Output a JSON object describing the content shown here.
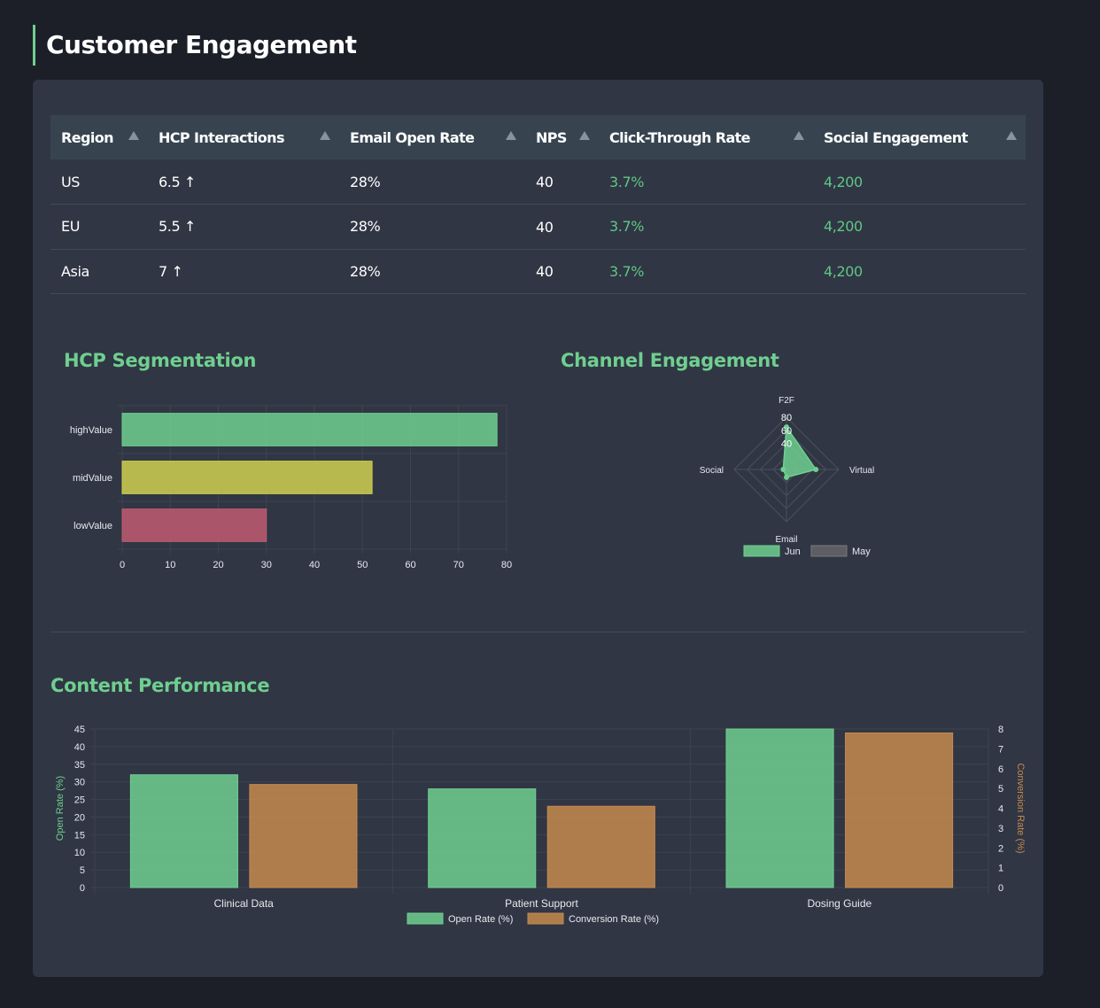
{
  "page": {
    "title": "Customer Engagement"
  },
  "table": {
    "columns": [
      "Region",
      "HCP Interactions",
      "Email Open Rate",
      "NPS",
      "Click-Through Rate",
      "Social Engagement"
    ],
    "rows": [
      {
        "region": "US",
        "hcp": "6.5 ↑",
        "email": "28%",
        "nps": "40",
        "ctr": "3.7%",
        "social": "4,200"
      },
      {
        "region": "EU",
        "hcp": "5.5 ↑",
        "email": "28%",
        "nps": "40",
        "ctr": "3.7%",
        "social": "4,200"
      },
      {
        "region": "Asia",
        "hcp": "7 ↑",
        "email": "28%",
        "nps": "40",
        "ctr": "3.7%",
        "social": "4,200"
      }
    ]
  },
  "sections": {
    "segmentation": "HCP Segmentation",
    "channel": "Channel Engagement",
    "content": "Content Performance"
  },
  "colors": {
    "accent": "#6fcf8f",
    "green": "#6fcf8f",
    "yellow": "#cfcf4f",
    "red": "#c05a70",
    "orange": "#c68a4e",
    "gray": "#7a7a7a"
  },
  "chart_data": [
    {
      "type": "bar",
      "orientation": "horizontal",
      "title": "HCP Segmentation",
      "categories": [
        "highValue",
        "midValue",
        "lowValue"
      ],
      "values": [
        78,
        52,
        30
      ],
      "xlim": [
        0,
        80
      ],
      "xticks": [
        0,
        10,
        20,
        30,
        40,
        50,
        60,
        70,
        80
      ],
      "grid": true
    },
    {
      "type": "radar",
      "title": "Channel Engagement",
      "axes": [
        "F2F",
        "Virtual",
        "Email",
        "Social"
      ],
      "rlim": [
        0,
        80
      ],
      "rticks": [
        40,
        60,
        80
      ],
      "series": [
        {
          "name": "Jun",
          "values": [
            65,
            45,
            12,
            5
          ]
        },
        {
          "name": "May",
          "values": [
            0,
            0,
            0,
            0
          ]
        }
      ],
      "legend": "bottom"
    },
    {
      "type": "bar",
      "title": "Content Performance",
      "categories": [
        "Clinical Data",
        "Patient Support",
        "Dosing Guide"
      ],
      "series": [
        {
          "name": "Open Rate (%)",
          "axis": "left",
          "values": [
            32,
            28,
            45
          ]
        },
        {
          "name": "Conversion Rate (%)",
          "axis": "right",
          "values": [
            5.2,
            4.1,
            7.8
          ]
        }
      ],
      "ylabel": "Open Rate (%)",
      "y2label": "Conversion Rate (%)",
      "ylim": [
        0,
        45
      ],
      "y2lim": [
        0,
        8
      ],
      "yticks": [
        0,
        5,
        10,
        15,
        20,
        25,
        30,
        35,
        40,
        45
      ],
      "y2ticks": [
        0,
        1,
        2,
        3,
        4,
        5,
        6,
        7,
        8
      ],
      "legend": "bottom",
      "grid": true
    }
  ]
}
